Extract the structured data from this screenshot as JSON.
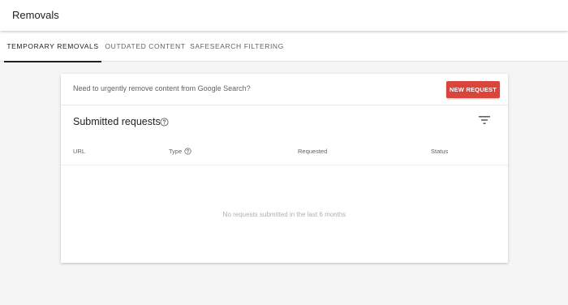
{
  "header": {
    "title": "Removals"
  },
  "tabs": [
    {
      "label": "TEMPORARY REMOVALS",
      "active": true
    },
    {
      "label": "OUTDATED CONTENT",
      "active": false
    },
    {
      "label": "SAFESEARCH FILTERING",
      "active": false
    }
  ],
  "card": {
    "banner_text": "Need to urgently remove content from Google Search?",
    "new_request_label": "NEW REQUEST",
    "section_title": "Submitted requests",
    "columns": [
      "URL",
      "Type",
      "Requested",
      "Status"
    ],
    "empty_message": "No requests submitted in the last 6 months"
  },
  "icons": {
    "help": "help-circle-icon",
    "filter": "filter-list-icon"
  },
  "colors": {
    "accent_button": "#d9453d",
    "active_tab": "#202124",
    "background": "#f5f5f5"
  }
}
